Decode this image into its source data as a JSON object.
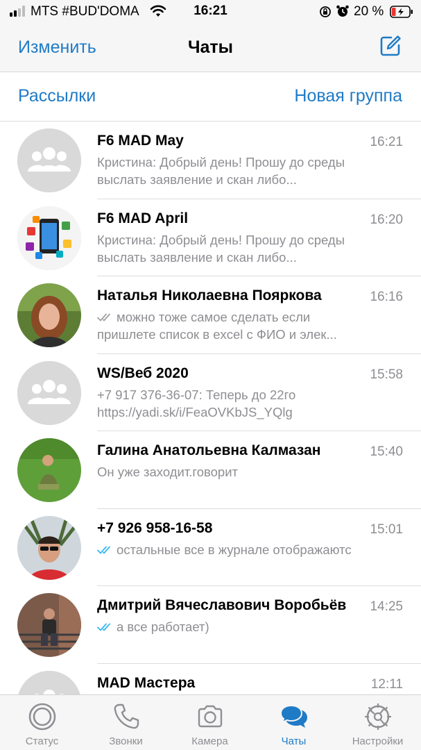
{
  "status_bar": {
    "carrier": "MTS #BUD'DOMA",
    "time": "16:21",
    "battery": "20 %"
  },
  "nav": {
    "edit_label": "Изменить",
    "title": "Чаты"
  },
  "links": {
    "broadcast_label": "Рассылки",
    "new_group_label": "Новая группа"
  },
  "chats": [
    {
      "name": "F6 MAD May",
      "time": "16:21",
      "sender": "Кристина",
      "message": ": Добрый день! Прошу до среды выслать заявление и скан либо...",
      "ticks": "none",
      "avatar": "group-icon"
    },
    {
      "name": "F6 MAD April",
      "time": "16:20",
      "sender": "Кристина",
      "message": ": Добрый день! Прошу до среды выслать заявление и скан либо...",
      "ticks": "none",
      "avatar": "apps-photo"
    },
    {
      "name": "Наталья Николаевна Пояркова",
      "time": "16:16",
      "sender": "",
      "message": "можно тоже самое сделать если пришлете список в excel с ФИО и элек...",
      "ticks": "grey",
      "avatar": "woman-photo"
    },
    {
      "name": "WS/Веб 2020",
      "time": "15:58",
      "sender": "+7 917 376-36-07",
      "message": ": Теперь до 22го https://yadi.sk/i/FeaOVKbJS_YQlg",
      "ticks": "none",
      "avatar": "group-icon"
    },
    {
      "name": "Галина Анатольевна Калмазан",
      "time": "15:40",
      "sender": "",
      "message": "Он уже заходит.говорит",
      "ticks": "none",
      "avatar": "grass-photo"
    },
    {
      "name": "+7 926 958-16-58",
      "time": "15:01",
      "sender": "",
      "message": "остальные все в журнале отображаютс",
      "ticks": "blue",
      "avatar": "man-sunglasses-photo"
    },
    {
      "name": "Дмитрий Вячеславович Воробьёв",
      "time": "14:25",
      "sender": "",
      "message": "а все работает)",
      "ticks": "blue",
      "avatar": "man-stairs-photo"
    },
    {
      "name": "MAD Мастера",
      "time": "12:11",
      "sender": "",
      "message": "",
      "ticks": "none",
      "avatar": "group-icon"
    }
  ],
  "tabs": [
    {
      "label": "Статус",
      "icon": "status-icon",
      "active": false
    },
    {
      "label": "Звонки",
      "icon": "phone-icon",
      "active": false
    },
    {
      "label": "Камера",
      "icon": "camera-icon",
      "active": false
    },
    {
      "label": "Чаты",
      "icon": "chats-icon",
      "active": true
    },
    {
      "label": "Настройки",
      "icon": "gear-icon",
      "active": false
    }
  ],
  "colors": {
    "accent": "#1f7bc6",
    "secondary_text": "#8e8e93",
    "read_ticks": "#34b7f1",
    "bar_background": "#f6f6f6"
  }
}
